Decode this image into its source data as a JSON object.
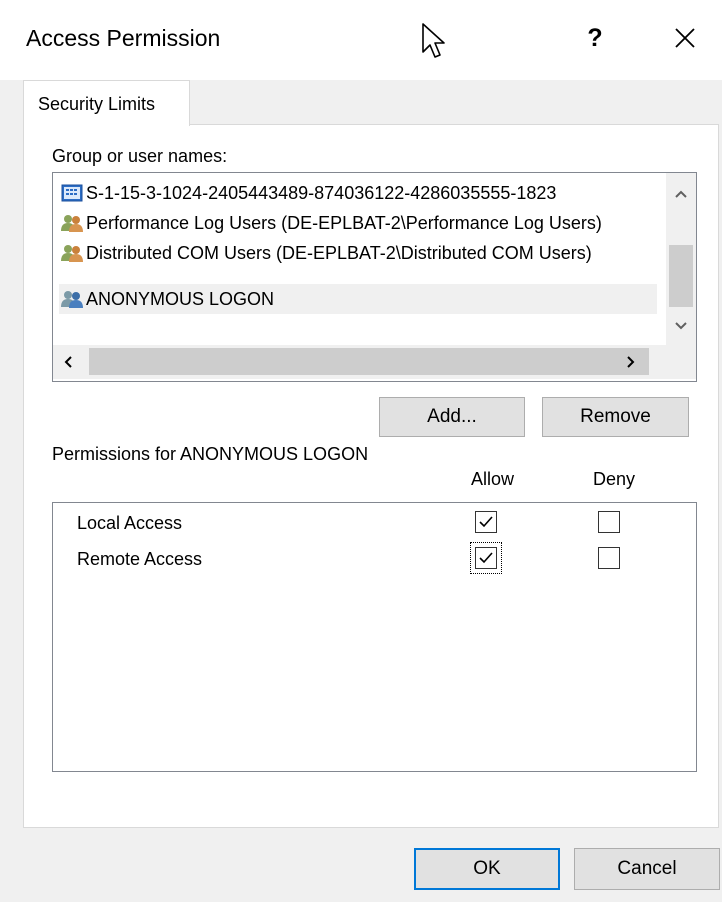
{
  "window": {
    "title": "Access Permission",
    "help_glyph": "?"
  },
  "tabs": [
    {
      "label": "Security Limits"
    }
  ],
  "groups": {
    "label": "Group or user names:",
    "items": [
      {
        "name": "S-1-15-3-1024-2405443489-874036122-4286035555-1823",
        "icon": "sid-icon"
      },
      {
        "name": "Performance Log Users (DE-EPLBAT-2\\Performance Log Users)",
        "icon": "users-icon"
      },
      {
        "name": "Distributed COM Users (DE-EPLBAT-2\\Distributed COM Users)",
        "icon": "users-icon"
      },
      {
        "name": "ANONYMOUS LOGON",
        "icon": "users-icon",
        "selected": true
      }
    ]
  },
  "buttons": {
    "add": "Add...",
    "remove": "Remove",
    "ok": "OK",
    "cancel": "Cancel"
  },
  "permissions": {
    "label": "Permissions for ANONYMOUS LOGON",
    "allow_header": "Allow",
    "deny_header": "Deny",
    "rows": [
      {
        "name": "Local Access",
        "allow": true,
        "deny": false
      },
      {
        "name": "Remote Access",
        "allow": true,
        "deny": false
      }
    ]
  },
  "colors": {
    "accent": "#0078d7",
    "window_bg": "#f0f0f0",
    "selection_bg": "#f0f0f0"
  }
}
